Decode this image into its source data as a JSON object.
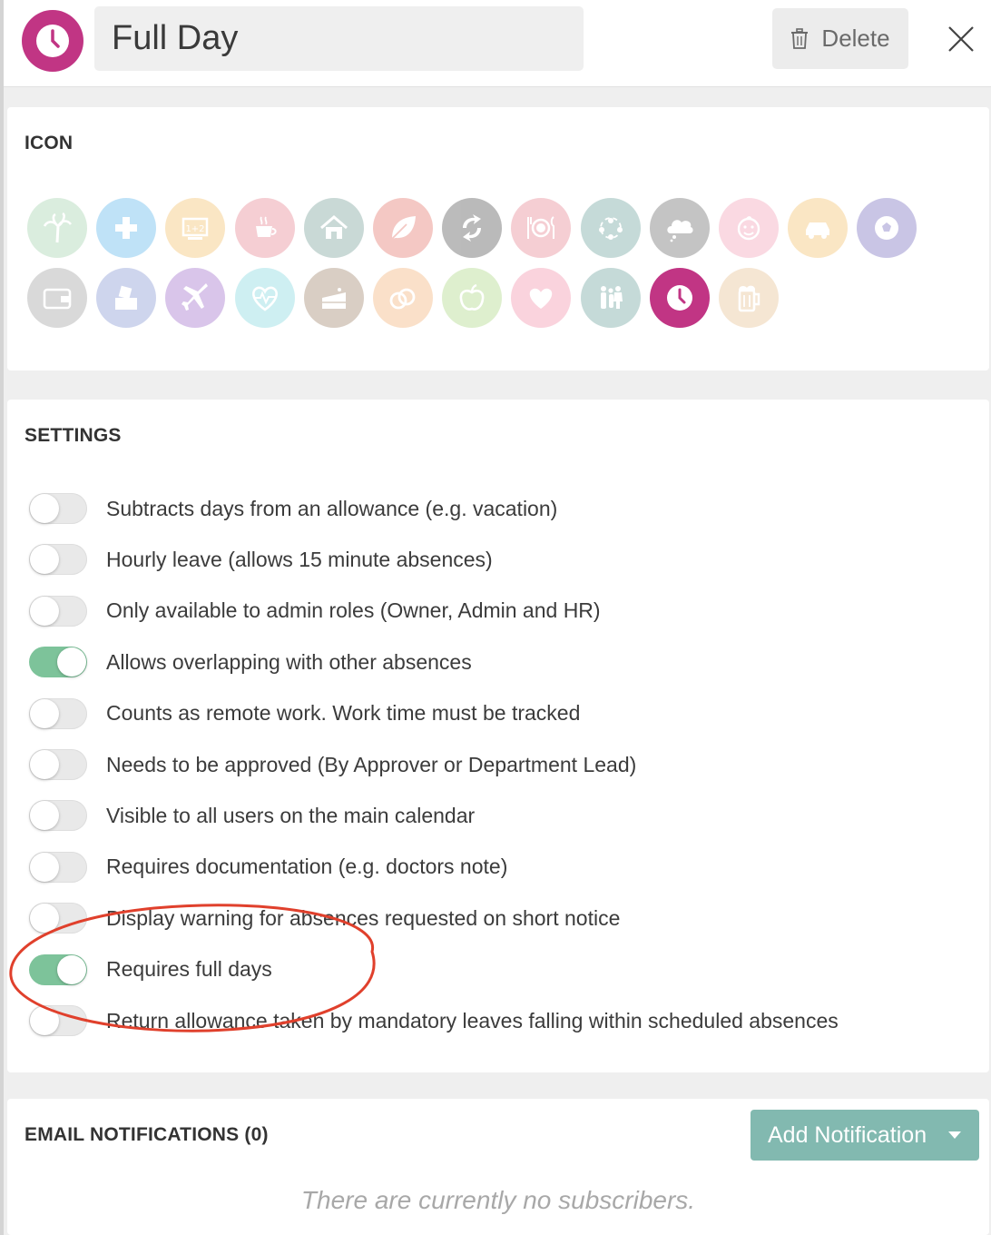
{
  "header": {
    "title": "Full Day",
    "delete_label": "Delete",
    "icon": "clock-icon",
    "accent_color": "#c13584"
  },
  "icon_section": {
    "title": "ICON",
    "selected": "clock-icon",
    "icons": [
      {
        "name": "palm-tree-icon",
        "color": "#8fc89a"
      },
      {
        "name": "medical-cross-icon",
        "color": "#3aa7e8"
      },
      {
        "name": "education-icon",
        "color": "#f2b24a"
      },
      {
        "name": "coffee-cup-icon",
        "color": "#e2697a"
      },
      {
        "name": "home-icon",
        "color": "#5a8a82"
      },
      {
        "name": "leaf-icon",
        "color": "#e0584a"
      },
      {
        "name": "sync-icon",
        "color": "#2b2b2b"
      },
      {
        "name": "dining-icon",
        "color": "#e2697a"
      },
      {
        "name": "team-icon",
        "color": "#4e8f88"
      },
      {
        "name": "cloud-icon",
        "color": "#4a4a4a"
      },
      {
        "name": "baby-icon",
        "color": "#f08aa8"
      },
      {
        "name": "car-icon",
        "color": "#f2b24a"
      },
      {
        "name": "soccer-ball-icon",
        "color": "#5a4fb0"
      },
      {
        "name": "wallet-icon",
        "color": "#8a8a8a"
      },
      {
        "name": "ballot-box-icon",
        "color": "#6a7fc8"
      },
      {
        "name": "airplane-icon",
        "color": "#8a4fc0"
      },
      {
        "name": "heartbeat-icon",
        "color": "#6ad0d8"
      },
      {
        "name": "cake-icon",
        "color": "#8a6a4a"
      },
      {
        "name": "rings-icon",
        "color": "#f2a25a"
      },
      {
        "name": "apple-icon",
        "color": "#9ad068"
      },
      {
        "name": "heart-icon",
        "color": "#f07898"
      },
      {
        "name": "family-icon",
        "color": "#4e8f88"
      },
      {
        "name": "clock-icon",
        "color": "#c13584"
      },
      {
        "name": "beer-icon",
        "color": "#e2b27a"
      }
    ]
  },
  "settings": {
    "title": "SETTINGS",
    "on_color": "#7dc39a",
    "items": [
      {
        "label": "Subtracts days from an allowance (e.g. vacation)",
        "enabled": false
      },
      {
        "label": "Hourly leave (allows 15 minute absences)",
        "enabled": false
      },
      {
        "label": "Only available to admin roles (Owner, Admin and HR)",
        "enabled": false
      },
      {
        "label": "Allows overlapping with other absences",
        "enabled": true
      },
      {
        "label": "Counts as remote work. Work time must be tracked",
        "enabled": false
      },
      {
        "label": "Needs to be approved (By Approver or Department Lead)",
        "enabled": false
      },
      {
        "label": "Visible to all users on the main calendar",
        "enabled": false
      },
      {
        "label": "Requires documentation (e.g. doctors note)",
        "enabled": false
      },
      {
        "label": "Display warning for absences requested on short notice",
        "enabled": false
      },
      {
        "label": "Requires full days",
        "enabled": true
      },
      {
        "label": "Return allowance taken by mandatory leaves falling within scheduled absences",
        "enabled": false
      }
    ]
  },
  "email_notifications": {
    "title": "EMAIL NOTIFICATIONS (0)",
    "add_label": "Add Notification",
    "empty_message": "There are currently no subscribers.",
    "button_color": "#82b9b0"
  },
  "annotation": {
    "color": "#e0402c"
  }
}
